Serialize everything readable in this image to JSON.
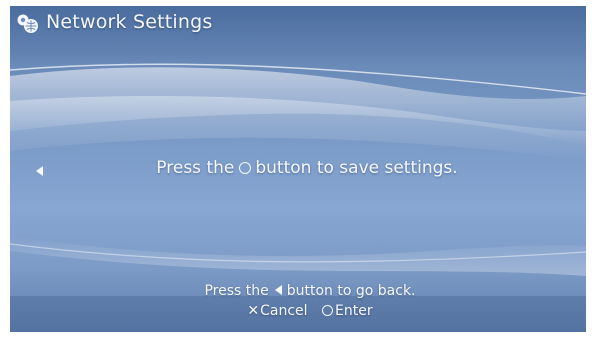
{
  "header": {
    "title": "Network Settings",
    "icon": "network-settings-icon"
  },
  "main": {
    "message_before": "Press the",
    "message_button_icon": "circle-button-icon",
    "message_after": "button to save settings.",
    "left_nav_icon": "left-arrow-icon"
  },
  "footer": {
    "back_before": "Press the",
    "back_button_icon": "left-dpad-icon",
    "back_after": "button to go back.",
    "cancel_label": "Cancel",
    "cancel_icon": "cross-button-icon",
    "enter_label": "Enter",
    "enter_icon": "circle-button-icon"
  },
  "colors": {
    "background_top": "#5d7fae",
    "background_mid": "#88a6d2",
    "text": "#f6f8fc"
  }
}
